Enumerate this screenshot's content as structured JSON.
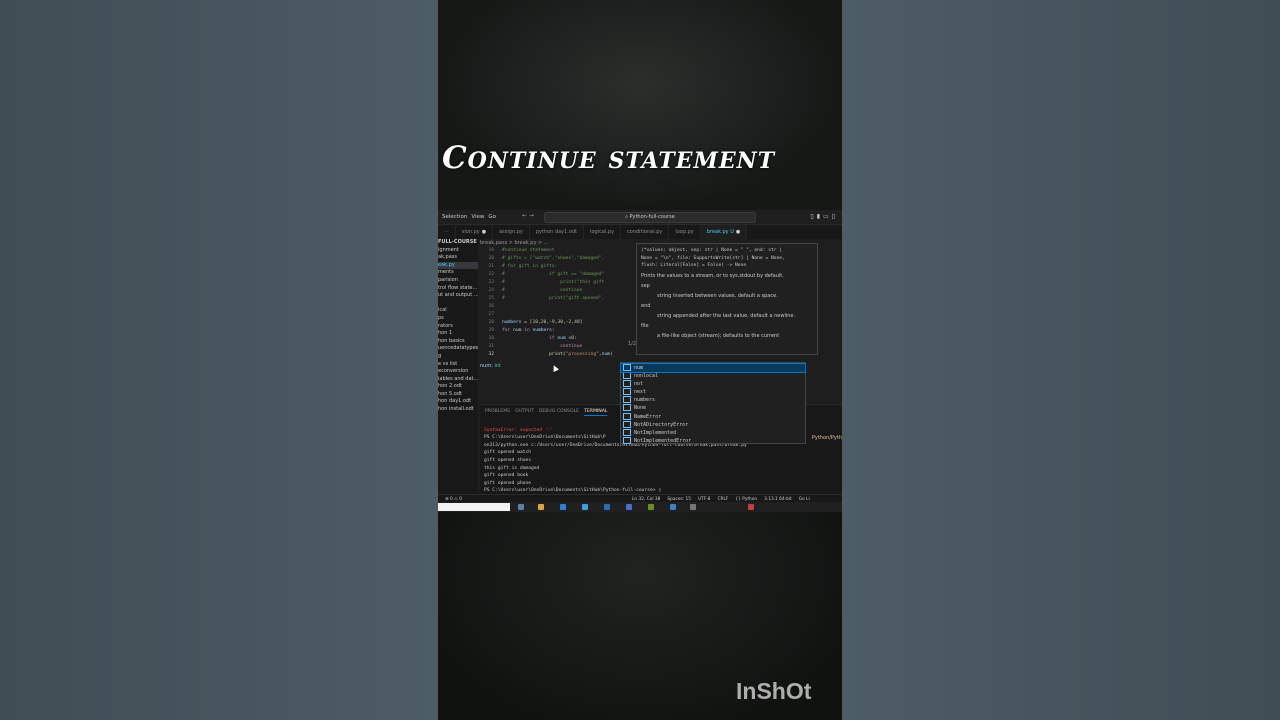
{
  "overlay": {
    "title": "Continue statement",
    "watermark": "InShOt"
  },
  "menubar": {
    "items": [
      "Selection",
      "View",
      "Go"
    ],
    "command_center": "Python-full-course"
  },
  "tabs": [
    {
      "label": "sion.py",
      "active": false,
      "dirty": true
    },
    {
      "label": "assign.py",
      "active": false,
      "dirty": false
    },
    {
      "label": "python day1.odt",
      "active": false,
      "dirty": false
    },
    {
      "label": "logical.py",
      "active": false,
      "dirty": false
    },
    {
      "label": "conditional.py",
      "active": false,
      "dirty": false
    },
    {
      "label": "loop.py",
      "active": false,
      "dirty": false
    },
    {
      "label": "break.py U",
      "active": true,
      "dirty": true
    }
  ],
  "sidebar": {
    "items": [
      {
        "label": "FULL-COURSE",
        "selected": false,
        "head": true
      },
      {
        "label": "ignment",
        "selected": false
      },
      {
        "label": "ak,pass",
        "selected": false
      },
      {
        "label": "eak.py",
        "selected": true
      },
      {
        "label": "ments",
        "selected": false
      },
      {
        "label": "parision",
        "selected": false
      },
      {
        "label": "trol flow state...",
        "selected": false
      },
      {
        "label": "ut and output ...",
        "selected": false
      },
      {
        "label": "",
        "selected": false
      },
      {
        "label": "ical",
        "selected": false
      },
      {
        "label": "ps",
        "selected": false
      },
      {
        "label": "rators",
        "selected": false
      },
      {
        "label": "hon 1",
        "selected": false
      },
      {
        "label": "hon basics",
        "selected": false
      },
      {
        "label": "uencedatatypes",
        "selected": false
      },
      {
        "label": "g",
        "selected": false
      },
      {
        "label": "e vs list",
        "selected": false
      },
      {
        "label": "econversion",
        "selected": false
      },
      {
        "label": "iables and dat...",
        "selected": false
      },
      {
        "label": "hon 2.odt",
        "selected": false
      },
      {
        "label": "hon 5.odt",
        "selected": false
      },
      {
        "label": "hon day1.odt",
        "selected": false
      },
      {
        "label": "hon install.odt",
        "selected": false
      }
    ]
  },
  "editor": {
    "breadcrumb": "break,pass  >  break.py  >  ...",
    "lines": [
      {
        "n": "19",
        "segments": [
          [
            "cm",
            "#continue statement"
          ]
        ]
      },
      {
        "n": "20",
        "segments": [
          [
            "cm",
            "# gifts = [\"watch\",\"shoes\",\"damaged\","
          ]
        ]
      },
      {
        "n": "21",
        "segments": [
          [
            "cm",
            "# for gift in gifts:"
          ]
        ]
      },
      {
        "n": "22",
        "segments": [
          [
            "cm",
            "#                if gift == \"damaged\""
          ]
        ]
      },
      {
        "n": "23",
        "segments": [
          [
            "cm",
            "#                    print(\"this gift"
          ]
        ]
      },
      {
        "n": "24",
        "segments": [
          [
            "cm",
            "#                    continue"
          ]
        ]
      },
      {
        "n": "25",
        "segments": [
          [
            "cm",
            "#                print(\"gift opened\","
          ]
        ]
      },
      {
        "n": "26",
        "segments": []
      },
      {
        "n": "27",
        "segments": []
      },
      {
        "n": "28",
        "segments": [
          [
            "var",
            "numbers"
          ],
          [
            "plain",
            " = ["
          ],
          [
            "num",
            "10"
          ],
          [
            "plain",
            ","
          ],
          [
            "num",
            "20"
          ],
          [
            "plain",
            ",-"
          ],
          [
            "num",
            "9"
          ],
          [
            "plain",
            ","
          ],
          [
            "num",
            "30"
          ],
          [
            "plain",
            ",-"
          ],
          [
            "num",
            "2"
          ],
          [
            "plain",
            ","
          ],
          [
            "num",
            "40"
          ],
          [
            "plain",
            "]"
          ]
        ]
      },
      {
        "n": "29",
        "segments": [
          [
            "kw",
            "for"
          ],
          [
            "plain",
            " "
          ],
          [
            "var",
            "num"
          ],
          [
            "plain",
            " "
          ],
          [
            "kw",
            "in"
          ],
          [
            "plain",
            " "
          ],
          [
            "var",
            "numbers"
          ],
          [
            "plain",
            ":"
          ]
        ]
      },
      {
        "n": "30",
        "segments": [
          [
            "plain",
            "                 "
          ],
          [
            "kw",
            "if"
          ],
          [
            "plain",
            " "
          ],
          [
            "var",
            "num"
          ],
          [
            "plain",
            " <"
          ],
          [
            "num",
            "0"
          ],
          [
            "plain",
            ":"
          ]
        ]
      },
      {
        "n": "31",
        "segments": [
          [
            "plain",
            "                     "
          ],
          [
            "kw",
            "continue"
          ]
        ]
      },
      {
        "n": "32",
        "segments": [
          [
            "plain",
            "                 "
          ],
          [
            "fn",
            "print"
          ],
          [
            "plain",
            "("
          ],
          [
            "str",
            "\"processing\""
          ],
          [
            "plain",
            ","
          ],
          [
            "var",
            "num"
          ],
          [
            "plain",
            ")"
          ]
        ],
        "current": true
      }
    ],
    "hover": {
      "name": "num:",
      "type": "int"
    }
  },
  "signature_help": {
    "signature_lines": [
      "(*values: object, sep: str | None = \" \", end: str |",
      "None = \"\\n\", file: SupportsWrite[str] | None = None,",
      "flush: Literal[False] = False) -> None"
    ],
    "description": "Prints the values to a stream, or to sys.stdout by default.",
    "params": [
      {
        "name": "sep",
        "desc": "string inserted between values, default a space."
      },
      {
        "name": "end",
        "desc": "string appended after the last value, default a newline."
      },
      {
        "name": "file",
        "desc": "a file-like object (stream); defaults to the current"
      }
    ],
    "counter": "1/2"
  },
  "suggestions": [
    {
      "label": "num",
      "icon": "variable-icon",
      "selected": true
    },
    {
      "label": "nonlocal",
      "icon": "keyword-icon",
      "selected": false
    },
    {
      "label": "not",
      "icon": "keyword-icon",
      "selected": false
    },
    {
      "label": "next",
      "icon": "function-icon",
      "selected": false
    },
    {
      "label": "numbers",
      "icon": "variable-icon",
      "selected": false
    },
    {
      "label": "None",
      "icon": "keyword-icon",
      "selected": false
    },
    {
      "label": "NameError",
      "icon": "class-icon",
      "selected": false
    },
    {
      "label": "NotADirectoryError",
      "icon": "class-icon",
      "selected": false
    },
    {
      "label": "NotImplemented",
      "icon": "variable-icon",
      "selected": false
    },
    {
      "label": "NotImplementedError",
      "icon": "class-icon",
      "selected": false
    }
  ],
  "panel": {
    "tabs": [
      {
        "label": "PROBLEMS",
        "active": false
      },
      {
        "label": "OUTPUT",
        "active": false
      },
      {
        "label": "DEBUG CONSOLE",
        "active": false
      },
      {
        "label": "TERMINAL",
        "active": true
      }
    ],
    "side_label": "Python/Pyth",
    "terminal_lines": [
      {
        "text": "",
        "err": false
      },
      {
        "text": "SyntaxError: expected ':'",
        "err": true
      },
      {
        "text": "PS C:\\Users\\user\\OneDrive\\Documents\\GitHub\\P",
        "err": false
      },
      {
        "text": "on313/python.exe c:/Users/user/OneDrive/Documents/GitHub/Python-full-course/break,pass/break.py",
        "err": false
      },
      {
        "text": "gift opened watch",
        "err": false
      },
      {
        "text": "gift opened shoes",
        "err": false
      },
      {
        "text": "this gift is damaged",
        "err": false
      },
      {
        "text": "gift opened book",
        "err": false
      },
      {
        "text": "gift opened phone",
        "err": false
      },
      {
        "text": "PS C:\\Users\\user\\OneDrive\\Documents\\GitHub\\Python-full-course> ▯",
        "err": false
      }
    ]
  },
  "statusbar": {
    "left": "⊗ 0 ⚠ 0",
    "items": [
      "Ln 32, Col 38",
      "Spaces: 15",
      "UTF-8",
      "CRLF",
      "{} Python",
      "3.13.1 64-bit",
      "Go Li"
    ]
  },
  "colors": {
    "accent": "#0078d4",
    "editor_bg": "#1e1e1e",
    "sidebar_bg": "#181818",
    "comment": "#6a9955",
    "keyword": "#c586c0",
    "number": "#b5cea8",
    "string": "#ce9178"
  }
}
